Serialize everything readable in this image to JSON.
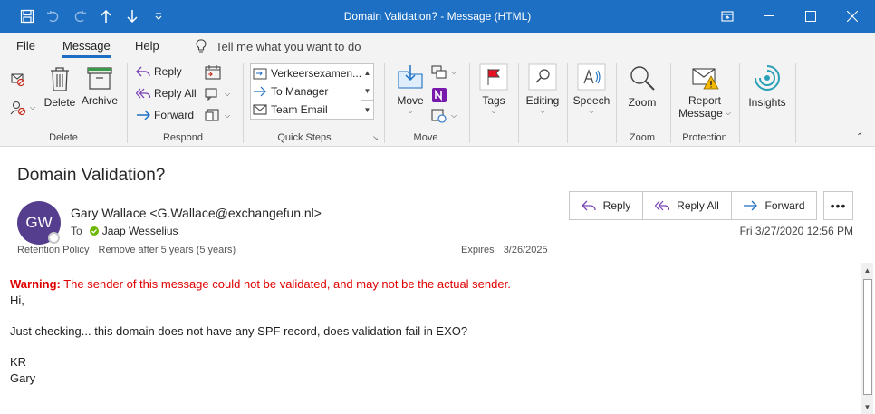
{
  "window": {
    "title": "Domain Validation?  -  Message (HTML)"
  },
  "menu": {
    "tabs": [
      "File",
      "Message",
      "Help"
    ],
    "tell_me": "Tell me what you want to do"
  },
  "ribbon": {
    "delete_group": {
      "label": "Delete",
      "delete": "Delete",
      "archive": "Archive"
    },
    "respond_group": {
      "label": "Respond",
      "reply": "Reply",
      "reply_all": "Reply All",
      "forward": "Forward"
    },
    "quick_steps_group": {
      "label": "Quick Steps",
      "items": [
        "Verkeersexamen...",
        "To Manager",
        "Team Email"
      ]
    },
    "move_group": {
      "label": "Move",
      "move": "Move"
    },
    "tags": {
      "label": "Tags"
    },
    "editing": {
      "label": "Editing"
    },
    "speech": {
      "label": "Speech"
    },
    "zoom_group": {
      "label": "Zoom",
      "zoom": "Zoom"
    },
    "protection_group": {
      "label": "Protection",
      "report_line1": "Report",
      "report_line2": "Message"
    },
    "insights": {
      "label": "Insights"
    }
  },
  "message": {
    "subject": "Domain Validation?",
    "avatar_initials": "GW",
    "avatar_color": "#553e8e",
    "sender": "Gary Wallace <G.Wallace@exchangefun.nl>",
    "to_label": "To",
    "recipient": "Jaap Wesselius",
    "retention_label": "Retention Policy",
    "retention_value": "Remove after 5 years (5 years)",
    "expires_label": "Expires",
    "expires_value": "3/26/2025",
    "date": "Fri 3/27/2020 12:56 PM",
    "actions": {
      "reply": "Reply",
      "reply_all": "Reply All",
      "forward": "Forward",
      "more": "•••"
    }
  },
  "body": {
    "warning_prefix": "Warning:",
    "warning_text": " The sender of this message could not be validated, and may not be the actual sender.",
    "lines": [
      "Hi,",
      "Just checking... this domain does not have any SPF record, does validation fail in EXO?",
      "KR",
      "Gary"
    ]
  },
  "colors": {
    "titlebar": "#1c6fc2",
    "accent": "#1c6fc2",
    "warning": "#e00000"
  }
}
